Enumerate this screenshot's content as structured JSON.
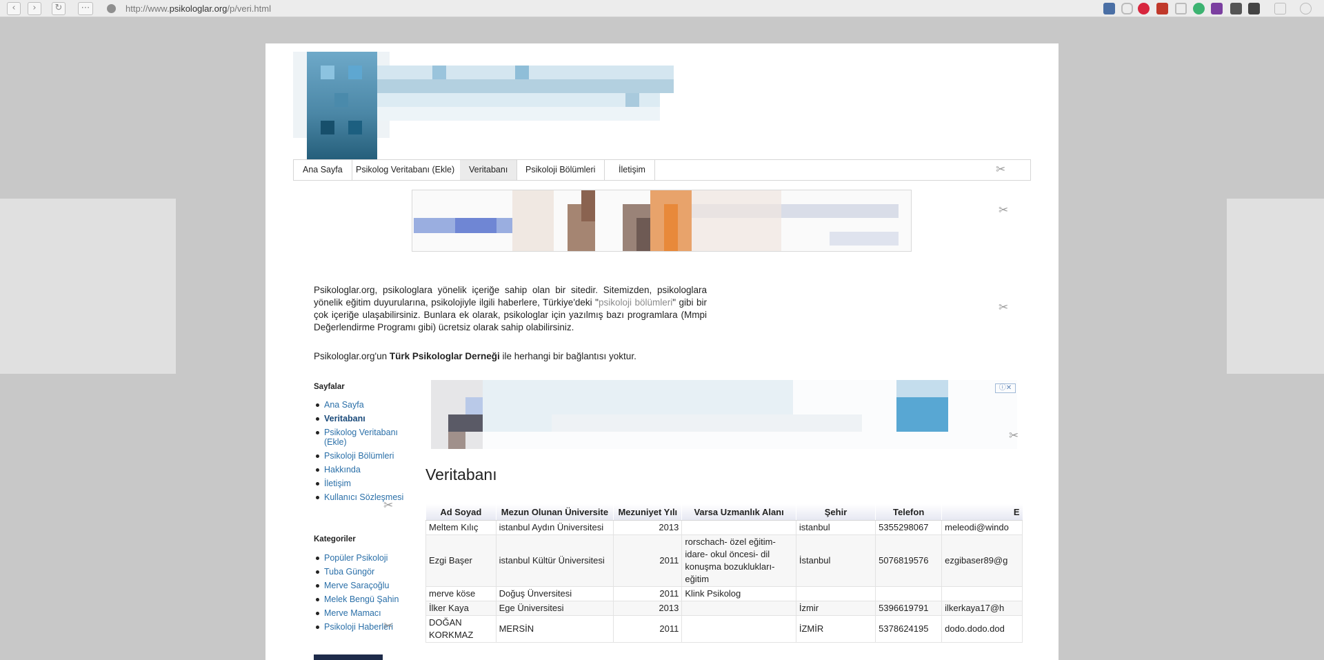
{
  "browser": {
    "url_prefix": "http://www.",
    "url_host": "psikologlar.org",
    "url_path": "/p/veri.html"
  },
  "nav": {
    "tabs": [
      "Ana Sayfa",
      "Psikolog Veritabanı (Ekle)",
      "Veritabanı",
      "Psikoloji Bölümleri",
      "İletişim"
    ],
    "active_index": 2
  },
  "intro": {
    "part1": "Psikologlar.org, psikologlara yönelik içeriğe sahip olan bir sitedir. Sitemizden, psikologlara yönelik eğitim duyurularına, psikolojiyle ilgili haberlere, Türkiye'deki \"",
    "link": "psikoloji bölümleri",
    "part2": "\" gibi bir çok içeriğe ulaşabilirsiniz. Bunlara ek olarak, psikologlar için yazılmış bazı programlara (Mmpi Değerlendirme Programı gibi) ücretsiz olarak sahip olabilirsiniz.",
    "disclaimer_pre": "Psikologlar.org'un ",
    "disclaimer_bold": "Türk Psikologlar Derneği",
    "disclaimer_post": " ile herhangi bir bağlantısı yoktur."
  },
  "sidebar": {
    "pages_heading": "Sayfalar",
    "pages": [
      "Ana Sayfa",
      "Veritabanı",
      "Psikolog Veritabanı (Ekle)",
      "Psikoloji Bölümleri",
      "Hakkında",
      "İletişim",
      "Kullanıcı Sözleşmesi"
    ],
    "current_page_index": 1,
    "categories_heading": "Kategoriler",
    "categories": [
      "Popüler Psikoloji",
      "Tuba Güngör",
      "Merve Saraçoğlu",
      "Melek Bengü Şahin",
      "Merve Mamacı",
      "Psikoloji Haberleri"
    ]
  },
  "main": {
    "title": "Veritabanı",
    "table": {
      "headers": [
        "Ad Soyad",
        "Mezun Olunan Üniversite",
        "Mezuniyet Yılı",
        "Varsa Uzmanlık Alanı",
        "Şehir",
        "Telefon",
        "E"
      ],
      "rows": [
        [
          "Meltem Kılıç",
          "istanbul Aydın Üniversitesi",
          "2013",
          "",
          "istanbul",
          "5355298067",
          "meleodi@windo"
        ],
        [
          "Ezgi Başer",
          "istanbul Kültür Üniversitesi",
          "2011",
          "rorschach- özel eğitim- idare- okul öncesi- dil konuşma bozuklukları- eğitim",
          "İstanbul",
          "5076819576",
          "ezgibaser89@g"
        ],
        [
          "merve köse",
          "Doğuş Ünversitesi",
          "2011",
          "Klink Psikolog",
          "",
          "",
          ""
        ],
        [
          "İlker Kaya",
          "Ege Üniversitesi",
          "2013",
          "",
          "İzmir",
          "5396619791",
          "ilkerkaya17@h"
        ],
        [
          "DOĞAN KORKMAZ",
          "MERSİN",
          "2011",
          "",
          "İZMİR",
          "5378624195",
          "dodo.dodo.dod"
        ]
      ]
    }
  },
  "colors": {
    "link": "#2a6fa8",
    "faded_link": "#8c8c8c",
    "header_gradient_end": "#e6e8f2"
  }
}
